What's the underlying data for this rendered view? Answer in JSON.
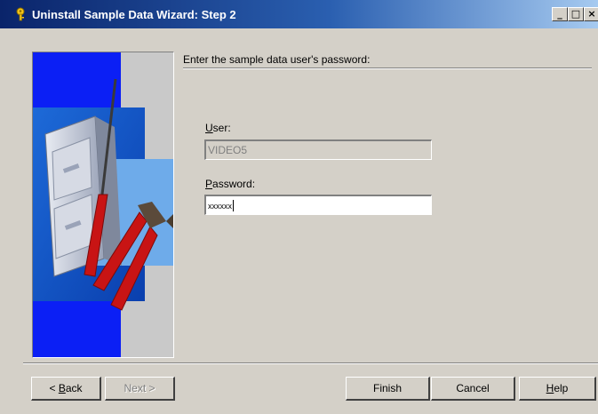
{
  "window": {
    "title": "Uninstall Sample Data Wizard: Step 2",
    "controls": {
      "minimize": "_",
      "maximize": "□",
      "close": "×"
    }
  },
  "main": {
    "heading": "Enter the sample data user's password:",
    "user": {
      "label_access": "U",
      "label_rest": "ser:",
      "value": "VIDEO5",
      "enabled": false
    },
    "password": {
      "label_access": "P",
      "label_rest": "assword:",
      "value": "xxxxxx",
      "enabled": true
    }
  },
  "buttons": {
    "back": {
      "pre": "< ",
      "access": "B",
      "rest": "ack",
      "enabled": true
    },
    "next": {
      "label": "Next >",
      "enabled": false
    },
    "finish": {
      "label": "Finish",
      "enabled": true
    },
    "cancel": {
      "label": "Cancel",
      "enabled": true
    },
    "help": {
      "access": "H",
      "rest": "elp",
      "enabled": true
    }
  },
  "colors": {
    "titlebar_start": "#0a246a",
    "titlebar_end": "#a6caf0",
    "dialog_bg": "#d4d0c8",
    "panel_blue": "#0b1ff5"
  },
  "icons": {
    "app": "wizard-key-icon",
    "illustration": "file-cabinet-screwdriver-pliers-illustration"
  }
}
